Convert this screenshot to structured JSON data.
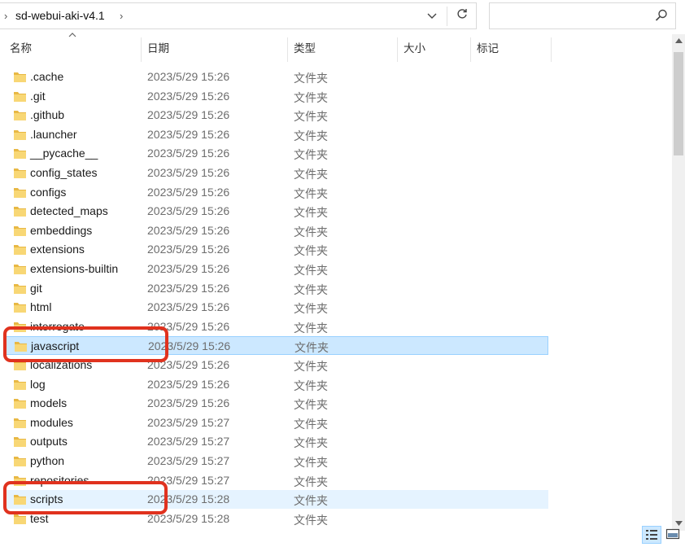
{
  "address": {
    "path": "sd-webui-aki-v4.1",
    "leading_chevron": "›",
    "trailing_chevron": "›",
    "dropdown_icon": "chevron-down-icon",
    "refresh_icon": "refresh-icon"
  },
  "search": {
    "placeholder": "",
    "icon": "search-icon"
  },
  "columns": {
    "name": "名称",
    "date": "日期",
    "type": "类型",
    "size": "大小",
    "tags": "标记"
  },
  "rows": [
    {
      "name": ".cache",
      "date": "2023/5/29 15:26",
      "type": "文件夹"
    },
    {
      "name": ".git",
      "date": "2023/5/29 15:26",
      "type": "文件夹"
    },
    {
      "name": ".github",
      "date": "2023/5/29 15:26",
      "type": "文件夹"
    },
    {
      "name": ".launcher",
      "date": "2023/5/29 15:26",
      "type": "文件夹"
    },
    {
      "name": "__pycache__",
      "date": "2023/5/29 15:26",
      "type": "文件夹"
    },
    {
      "name": "config_states",
      "date": "2023/5/29 15:26",
      "type": "文件夹"
    },
    {
      "name": "configs",
      "date": "2023/5/29 15:26",
      "type": "文件夹"
    },
    {
      "name": "detected_maps",
      "date": "2023/5/29 15:26",
      "type": "文件夹"
    },
    {
      "name": "embeddings",
      "date": "2023/5/29 15:26",
      "type": "文件夹"
    },
    {
      "name": "extensions",
      "date": "2023/5/29 15:26",
      "type": "文件夹"
    },
    {
      "name": "extensions-builtin",
      "date": "2023/5/29 15:26",
      "type": "文件夹"
    },
    {
      "name": "git",
      "date": "2023/5/29 15:26",
      "type": "文件夹"
    },
    {
      "name": "html",
      "date": "2023/5/29 15:26",
      "type": "文件夹"
    },
    {
      "name": "interrogate",
      "date": "2023/5/29 15:26",
      "type": "文件夹"
    },
    {
      "name": "javascript",
      "date": "2023/5/29 15:26",
      "type": "文件夹",
      "state": "selected",
      "highlighted": true
    },
    {
      "name": "localizations",
      "date": "2023/5/29 15:26",
      "type": "文件夹"
    },
    {
      "name": "log",
      "date": "2023/5/29 15:26",
      "type": "文件夹"
    },
    {
      "name": "models",
      "date": "2023/5/29 15:26",
      "type": "文件夹"
    },
    {
      "name": "modules",
      "date": "2023/5/29 15:27",
      "type": "文件夹"
    },
    {
      "name": "outputs",
      "date": "2023/5/29 15:27",
      "type": "文件夹"
    },
    {
      "name": "python",
      "date": "2023/5/29 15:27",
      "type": "文件夹"
    },
    {
      "name": "repositories",
      "date": "2023/5/29 15:27",
      "type": "文件夹"
    },
    {
      "name": "scripts",
      "date": "2023/5/29 15:28",
      "type": "文件夹",
      "state": "hover",
      "highlighted": true
    },
    {
      "name": "test",
      "date": "2023/5/29 15:28",
      "type": "文件夹"
    }
  ],
  "colors": {
    "selected_bg": "#cce8ff",
    "selected_border": "#99d1ff",
    "hover_bg": "#e5f3ff",
    "highlight_annotation": "#e0321e",
    "folder_yellow": "#f8d775"
  },
  "icons": {
    "folder": "folder-icon",
    "sort": "sort-ascending-icon",
    "details_view": "details-view-icon",
    "large_icons_view": "large-icons-view-icon"
  }
}
